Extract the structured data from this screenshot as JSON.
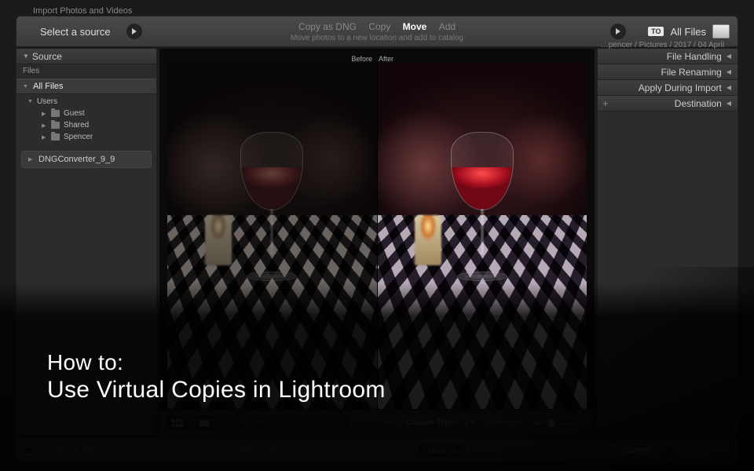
{
  "dialog_title": "Import Photos and Videos",
  "topbar": {
    "select_source": "Select a source",
    "modes": {
      "copy_dng": "Copy as DNG",
      "copy": "Copy",
      "move": "Move",
      "add": "Add"
    },
    "mode_sub": "Move photos to a new location and add to catalog",
    "to_badge": "TO",
    "dest_text": "All Files",
    "dest_path": "…pencer / Pictures / 2017 / 04 April"
  },
  "left": {
    "header": "Source",
    "files_label": "Files",
    "all_files": "All Files",
    "users": "Users",
    "guest": "Guest",
    "shared": "Shared",
    "spencer": "Spencer",
    "dng_converter": "DNGConverter_9_9"
  },
  "right": {
    "file_handling": "File Handling",
    "file_renaming": "File Renaming",
    "apply_during_import": "Apply During Import",
    "destination": "Destination"
  },
  "center": {
    "before": "Before",
    "after": "After",
    "check_all": "Check All",
    "uncheck_all": "Uncheck All",
    "sort_label": "Sort:",
    "sort_value": "Capture Time",
    "thumbs_label": "Thumbnails"
  },
  "bottom": {
    "status": "0 photos / 0 bytes",
    "preset_label": "Import Preset :",
    "preset_value": "None",
    "cancel": "Cancel",
    "import": "Import"
  },
  "overlay": {
    "line1": "How to:",
    "line2": "Use Virtual Copies in Lightroom"
  }
}
